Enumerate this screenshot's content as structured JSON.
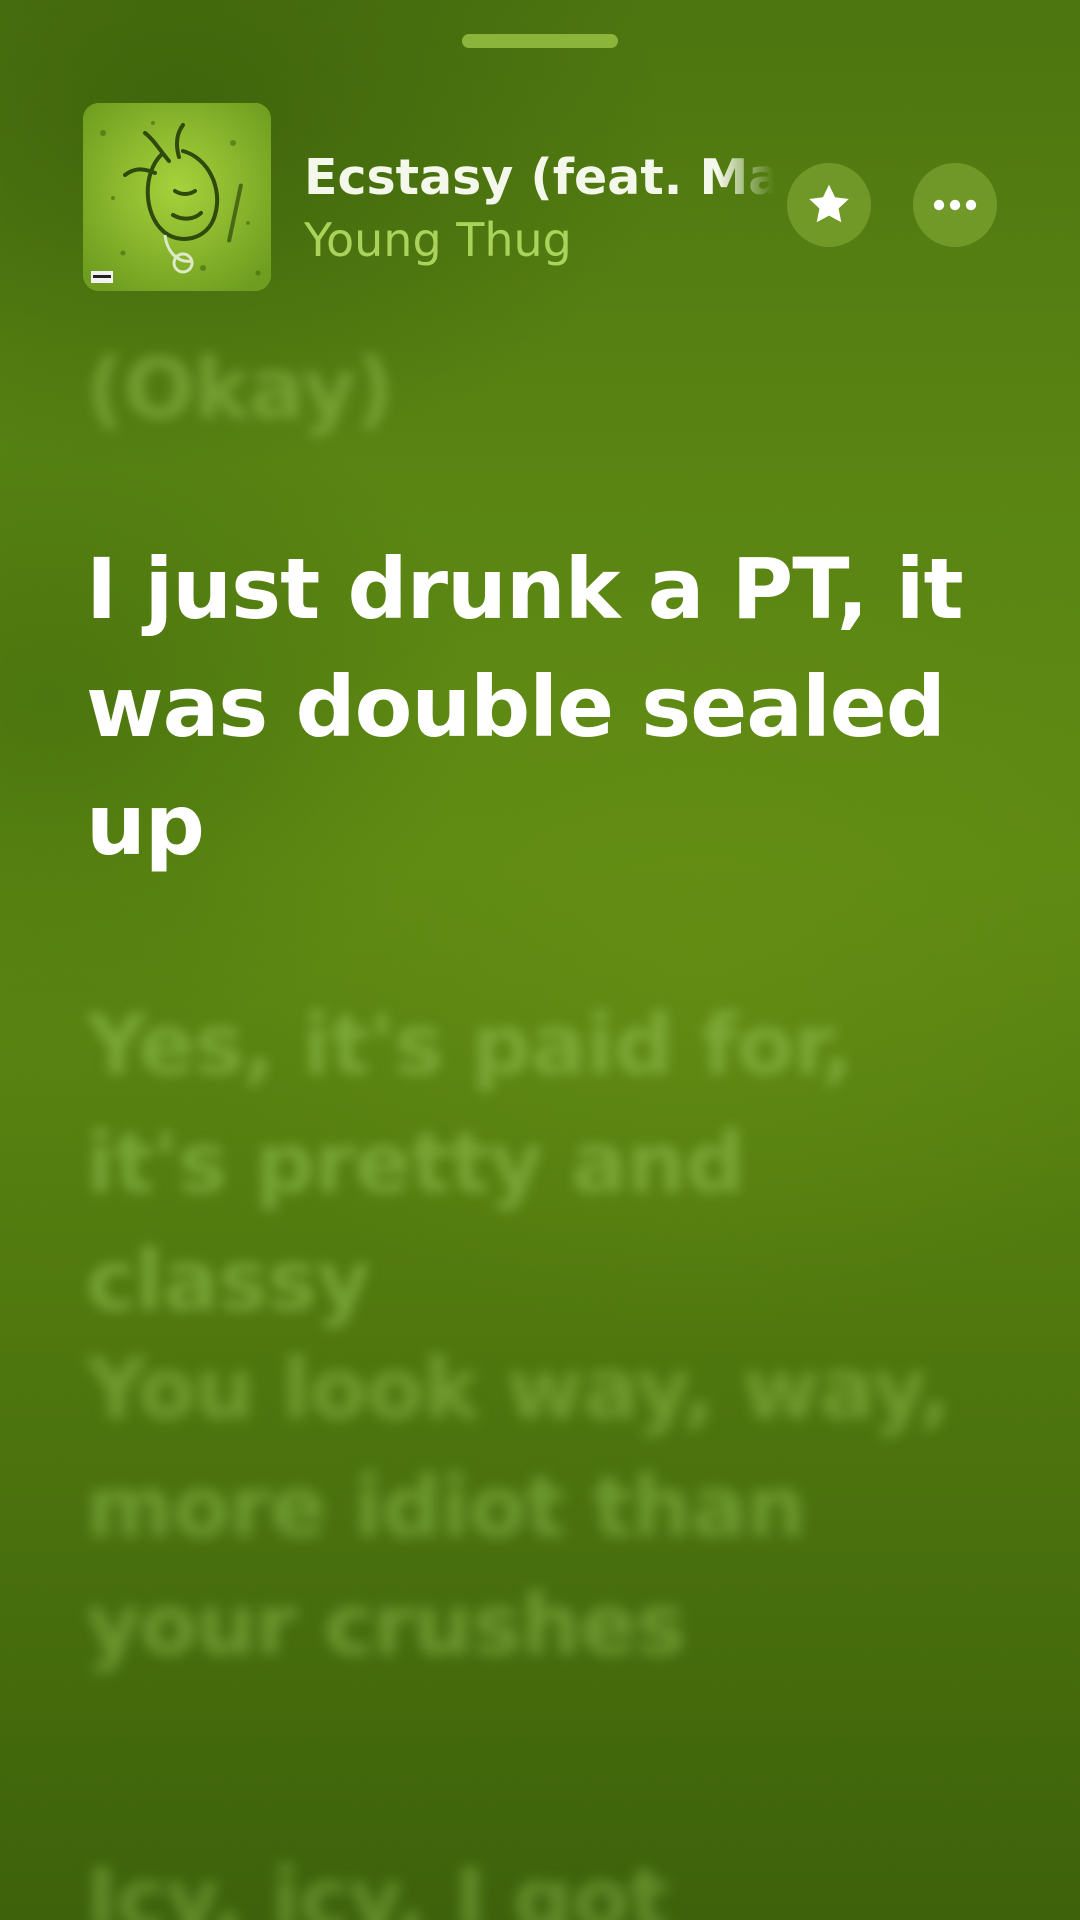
{
  "now_playing": {
    "title": "Ecstasy (feat. Machine Gun Kelly)",
    "artist": "Young Thug",
    "artwork_icon": "album-artwork",
    "favorite_icon": "star-icon",
    "more_icon": "ellipsis-icon"
  },
  "lyrics": {
    "past_line": "(Okay)",
    "current_line": "I just drunk a PT, it was double sealed up",
    "upcoming_lines": [
      "Yes, it's paid for, it's pretty and classy",
      "You look way, way, more idiot than your crushes",
      "Icy, icy, I got"
    ]
  },
  "colors": {
    "background": "#5a8513",
    "current_lyric": "#ffffff",
    "artist_text": "#a9d35a",
    "accent": "#8bb43a"
  }
}
